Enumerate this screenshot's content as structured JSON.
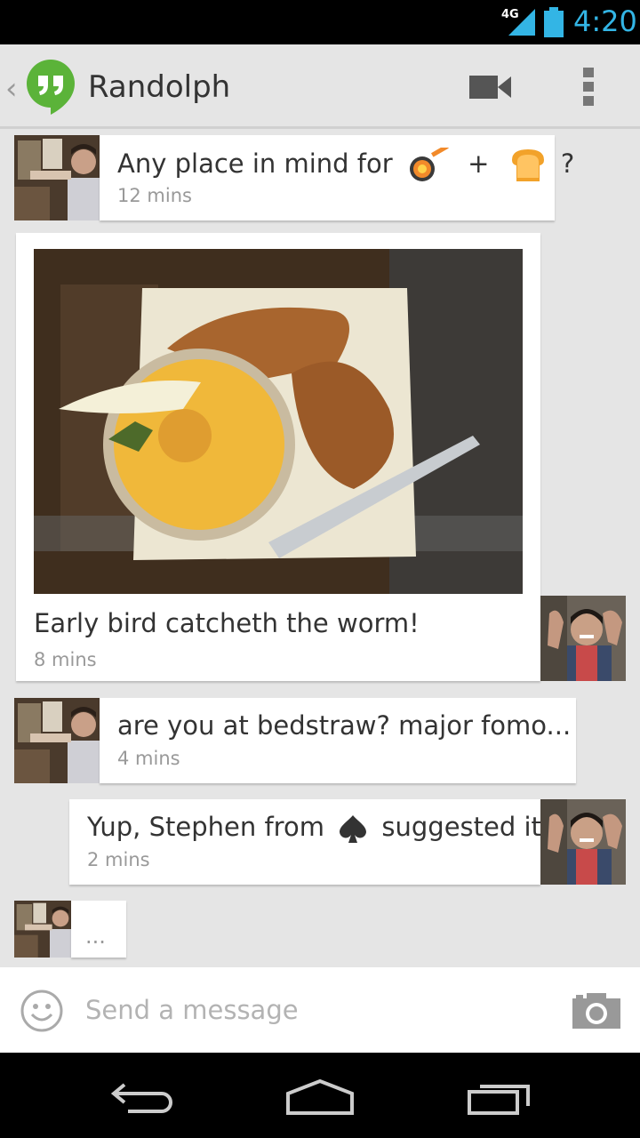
{
  "status_bar": {
    "network": "4G",
    "time": "4:20"
  },
  "header": {
    "contact_name": "Randolph"
  },
  "messages": [
    {
      "text_before": "Any place in mind for",
      "plus": "+",
      "question": "?",
      "time": "12 mins"
    },
    {
      "text": "Early bird catcheth the worm!",
      "time": "8 mins"
    },
    {
      "text": "are you at bedstraw? major fomo...",
      "time": "4 mins"
    },
    {
      "text_before": "Yup, Stephen from",
      "text_after": "suggested it",
      "time": "2 mins"
    },
    {
      "text": "..."
    }
  ],
  "compose": {
    "placeholder": "Send a message"
  },
  "colors": {
    "accent": "#33b5e5",
    "hangouts_green": "#5bb339",
    "background": "#e5e5e5"
  }
}
